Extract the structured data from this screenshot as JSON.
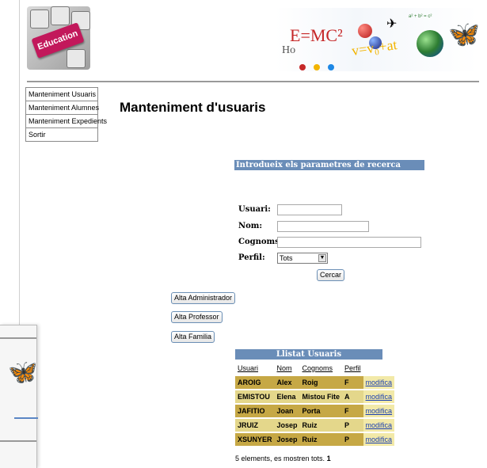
{
  "menu": {
    "items": [
      "Manteniment Usuaris",
      "Manteniment Alumnes",
      "Manteniment Expedients",
      "Sortir"
    ]
  },
  "header": {
    "logo_text": "Education",
    "banner_formula": "E=MC²",
    "banner_formula2": "v=v₀+at",
    "banner_ho": "Ho"
  },
  "page": {
    "title": "Manteniment d'usuaris"
  },
  "search": {
    "header": "Introdueix els parametres de recerca",
    "labels": {
      "usuari": "Usuari:",
      "nom": "Nom:",
      "cognoms": "Cognoms:",
      "perfil": "Perfil:"
    },
    "values": {
      "usuari": "",
      "nom": "",
      "cognoms": ""
    },
    "perfil_selected": "Tots",
    "button": "Cercar"
  },
  "actions": {
    "alta_admin": "Alta Administrador",
    "alta_professor": "Alta Professor",
    "alta_familia": "Alta Familia"
  },
  "table": {
    "title": "Llistat Usuaris",
    "columns": [
      "Usuari",
      "Nom",
      "Cognoms",
      "Perfil",
      ""
    ],
    "rows": [
      [
        "AROIG",
        "Alex",
        "Roig",
        "F",
        "modifica"
      ],
      [
        "EMISTOU",
        "Elena",
        "Mistou Fite",
        "A",
        "modifica"
      ],
      [
        "JAFITIO",
        "Joan",
        "Porta",
        "F",
        "modifica"
      ],
      [
        "JRUIZ",
        "Josep",
        "Ruiz",
        "P",
        "modifica"
      ],
      [
        "XSUNYER",
        "Josep",
        "Ruiz",
        "P",
        "modifica"
      ]
    ]
  },
  "footer": {
    "text": "5 elements, es mostren tots.",
    "page": "1"
  },
  "colors": {
    "accent": "#6a8db8",
    "row_dark": "#c6a845",
    "row_light": "#e4d78b",
    "link": "#1a3fb0"
  }
}
